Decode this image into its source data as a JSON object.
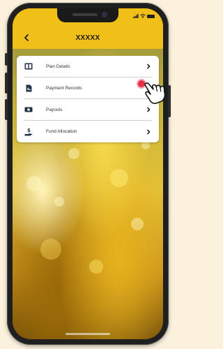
{
  "header": {
    "title": "XXXXX",
    "back_icon": "chevron-left-icon"
  },
  "menu": {
    "items": [
      {
        "label": "Plan Details",
        "icon": "book-icon"
      },
      {
        "label": "Payment Records",
        "icon": "document-icon"
      },
      {
        "label": "Payouts",
        "icon": "banknote-icon"
      },
      {
        "label": "Fund Allocation",
        "icon": "hand-money-icon"
      }
    ]
  },
  "colors": {
    "accent": "#f0c019",
    "background": "#fbf1dc",
    "tap_indicator": "#e5304a"
  }
}
